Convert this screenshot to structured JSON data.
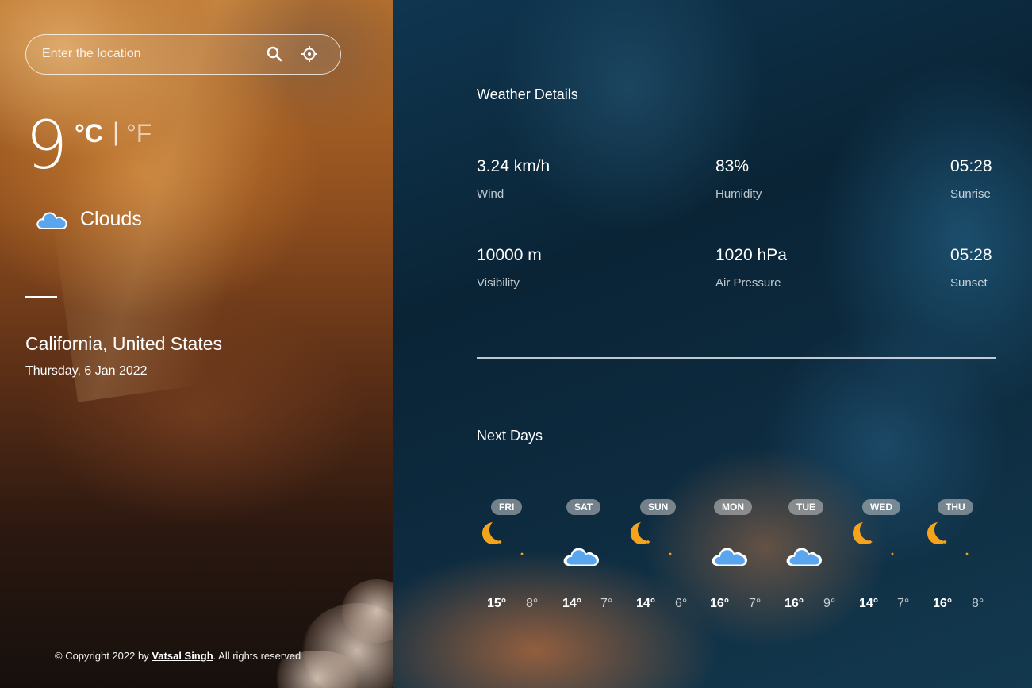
{
  "search": {
    "placeholder": "Enter the location"
  },
  "current": {
    "temperature": "9",
    "unit_celsius": "°C",
    "unit_separator": "|",
    "unit_fahrenheit": "°F",
    "condition": "Clouds",
    "condition_icon": "cloud-icon",
    "location": "California, United States",
    "date": "Thursday, 6 Jan 2022"
  },
  "details": {
    "title": "Weather Details",
    "items": [
      {
        "value": "3.24 km/h",
        "label": "Wind"
      },
      {
        "value": "83%",
        "label": "Humidity"
      },
      {
        "value": "05:28",
        "label": "Sunrise"
      },
      {
        "value": "10000 m",
        "label": "Visibility"
      },
      {
        "value": "1020 hPa",
        "label": "Air Pressure"
      },
      {
        "value": "05:28",
        "label": "Sunset"
      }
    ]
  },
  "forecast": {
    "title": "Next Days",
    "days": [
      {
        "day": "FRI",
        "icon": "moon-icon",
        "max": "15°",
        "min": "8°"
      },
      {
        "day": "SAT",
        "icon": "cloud-icon",
        "max": "14°",
        "min": "7°"
      },
      {
        "day": "SUN",
        "icon": "moon-icon",
        "max": "14°",
        "min": "6°"
      },
      {
        "day": "MON",
        "icon": "cloud-icon",
        "max": "16°",
        "min": "7°"
      },
      {
        "day": "TUE",
        "icon": "cloud-icon",
        "max": "16°",
        "min": "9°"
      },
      {
        "day": "WED",
        "icon": "moon-icon",
        "max": "14°",
        "min": "7°"
      },
      {
        "day": "THU",
        "icon": "moon-icon",
        "max": "16°",
        "min": "8°"
      }
    ]
  },
  "footer": {
    "prefix": "© Copyright 2022 by ",
    "author": "Vatsal Singh",
    "suffix": ". All rights reserved"
  },
  "colors": {
    "cloud": "#5aa6ee",
    "moon": "#f5a31a"
  }
}
